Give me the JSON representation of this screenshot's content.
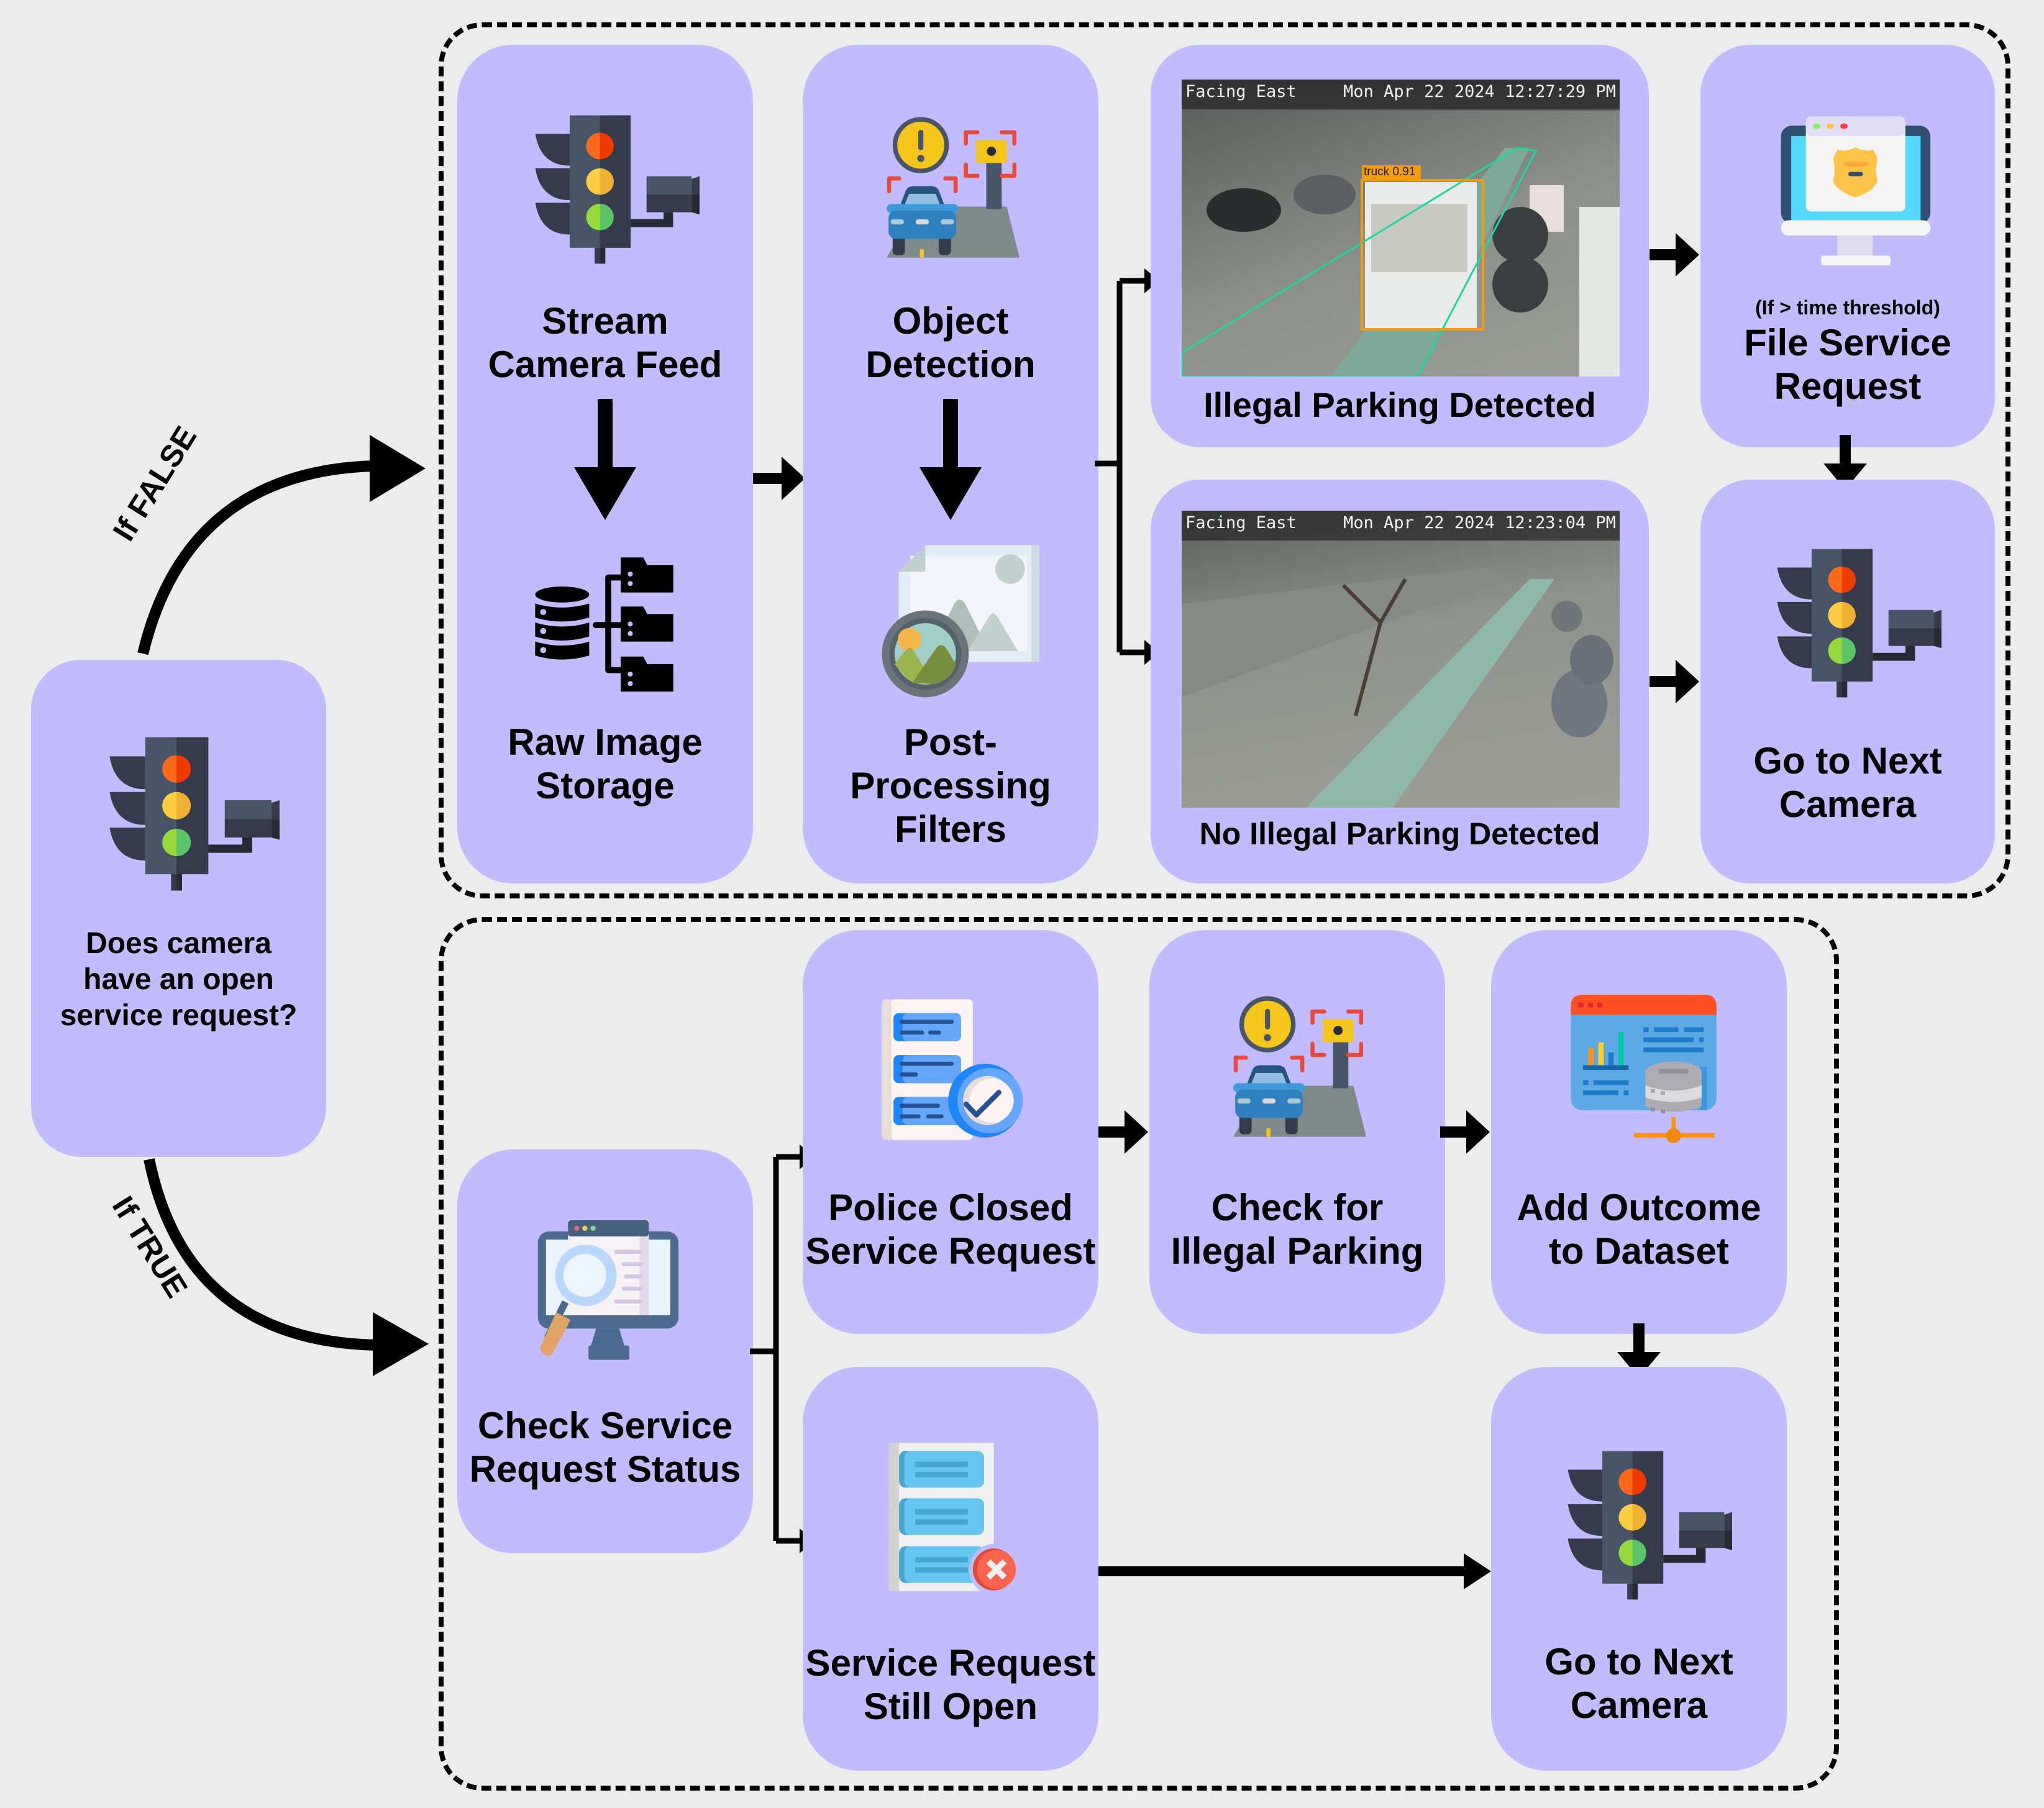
{
  "colors": {
    "background": "#ececec",
    "box_fill": "#c2bbfd",
    "arrow": "#000000",
    "detection_box": "#f39c12",
    "zone_outline": "#1ed6a0"
  },
  "decision": {
    "icon": "traffic-camera-icon",
    "label": "Does camera\nhave an open\nservice request?",
    "false_branch": "If FALSE",
    "true_branch": "If TRUE"
  },
  "false_path": {
    "stream": {
      "icon": "traffic-camera-icon",
      "label": "Stream\nCamera Feed"
    },
    "storage": {
      "icon": "database-folders-icon",
      "label": "Raw Image\nStorage"
    },
    "detection": {
      "icon": "car-warning-speed-camera-icon",
      "label": "Object\nDetection"
    },
    "filters": {
      "icon": "image-lens-icon",
      "label": "Post-\nProcessing\nFilters"
    },
    "illegal": {
      "label": "Illegal Parking Detected",
      "overlay_left": "Facing East",
      "overlay_right": "Mon Apr 22 2024 12:27:29 PM",
      "detection_label": "truck 0.91"
    },
    "no_illegal": {
      "label": "No Illegal Parking Detected",
      "overlay_left": "Facing East",
      "overlay_right": "Mon Apr 22 2024 12:23:04 PM"
    },
    "file_request": {
      "icon": "police-badge-monitor-icon",
      "note": "(If > time threshold)",
      "label": "File Service\nRequest"
    },
    "next_camera": {
      "icon": "traffic-camera-icon",
      "label": "Go to Next\nCamera"
    }
  },
  "true_path": {
    "check_status": {
      "icon": "monitor-search-icon",
      "label": "Check Service\nRequest Status"
    },
    "police_closed": {
      "icon": "document-check-icon",
      "label": "Police Closed\nService Request"
    },
    "still_open": {
      "icon": "document-cross-icon",
      "label": "Service Request\nStill Open"
    },
    "check_illegal": {
      "icon": "car-warning-speed-camera-icon",
      "label": "Check for\nIllegal Parking"
    },
    "add_outcome": {
      "icon": "dashboard-database-icon",
      "label": "Add Outcome\nto Dataset"
    },
    "next_camera": {
      "icon": "traffic-camera-icon",
      "label": "Go to Next\nCamera"
    }
  }
}
